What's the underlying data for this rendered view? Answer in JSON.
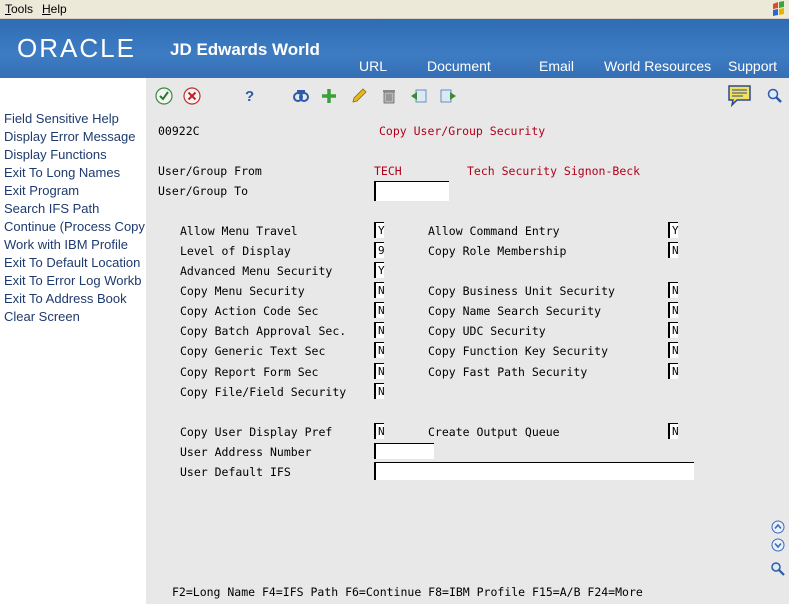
{
  "menubar": {
    "tools": "Tools",
    "help": "Help"
  },
  "header": {
    "brand": "ORACLE",
    "product": "JD Edwards World",
    "nav": [
      "URL",
      "Document",
      "Email",
      "World Resources",
      "Support"
    ]
  },
  "left_links": [
    "Field Sensitive Help",
    "Display Error Message",
    "Display Functions",
    "Exit To Long Names",
    "Exit Program",
    "Search IFS Path",
    "Continue (Process Copy",
    "Work with IBM Profile",
    "Exit To Default Location",
    "Exit To Error Log Workb",
    "Exit To Address Book",
    "Clear Screen"
  ],
  "form": {
    "program_id": "00922C",
    "title": "Copy User/Group Security",
    "from_label": "User/Group From",
    "from_value": "TECH",
    "from_desc": "Tech Security Signon-Beck",
    "to_label": "User/Group To",
    "to_value": "",
    "left_fields": [
      {
        "label": "Allow Menu Travel",
        "value": "Y"
      },
      {
        "label": "Level of Display",
        "value": "9"
      },
      {
        "label": "Advanced Menu Security",
        "value": "Y"
      },
      {
        "label": "Copy Menu Security",
        "value": "N"
      },
      {
        "label": "Copy Action Code Sec",
        "value": "N"
      },
      {
        "label": "Copy Batch Approval Sec.",
        "value": "N"
      },
      {
        "label": "Copy Generic Text Sec",
        "value": "N"
      },
      {
        "label": "Copy Report Form Sec",
        "value": "N"
      },
      {
        "label": "Copy File/Field Security",
        "value": "N"
      }
    ],
    "right_fields": [
      {
        "label": "Allow Command Entry",
        "value": "Y"
      },
      {
        "label": "Copy Role Membership",
        "value": "N"
      },
      {
        "label": "Copy Business Unit Security",
        "value": "N"
      },
      {
        "label": "Copy Name Search Security",
        "value": "N"
      },
      {
        "label": "Copy UDC Security",
        "value": "N"
      },
      {
        "label": "Copy Function Key Security",
        "value": "N"
      },
      {
        "label": "Copy Fast Path Security",
        "value": "N"
      }
    ],
    "display_pref_label": "Copy User Display Pref",
    "display_pref_value": "N",
    "output_queue_label": "Create Output Queue",
    "output_queue_value": "N",
    "address_label": "User Address Number",
    "address_value": "",
    "ifs_label": "User Default IFS",
    "ifs_value": "",
    "function_keys": "F2=Long Name F4=IFS Path F6=Continue F8=IBM Profile F15=A/B F24=More"
  },
  "colors": {
    "header_blue": "#356fb5",
    "title_red": "#b0001a",
    "link_blue": "#1e3a6e"
  }
}
